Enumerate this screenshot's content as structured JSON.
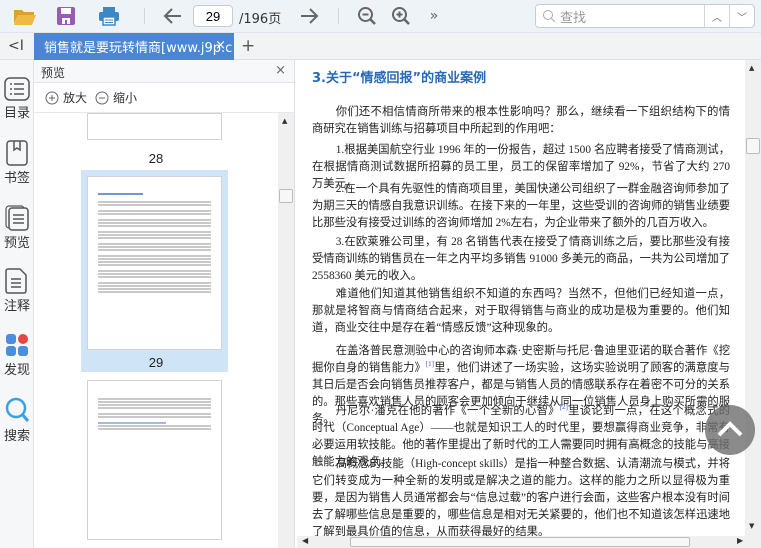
{
  "toolbar": {
    "page_current": "29",
    "page_total": "/196页",
    "search_placeholder": "查找",
    "icons": [
      "folder-open-icon",
      "save-icon",
      "print-icon",
      "arrow-left-icon",
      "arrow-right-icon",
      "zoom-out-icon",
      "zoom-in-icon",
      "more-icon",
      "search-icon",
      "chevron-up-icon",
      "chevron-down-icon"
    ]
  },
  "tabs": {
    "collapse": "<I",
    "doc_tab": "销售就是要玩转情商[www.j9p.c",
    "close": "×",
    "add": "+"
  },
  "rail": [
    {
      "label": "目录",
      "icon": "list-icon"
    },
    {
      "label": "书签",
      "icon": "bookmark-icon"
    },
    {
      "label": "预览",
      "icon": "preview-icon"
    },
    {
      "label": "注释",
      "icon": "note-icon"
    },
    {
      "label": "发现",
      "icon": "discover-icon"
    },
    {
      "label": "搜索",
      "icon": "search-icon"
    }
  ],
  "preview": {
    "title": "预览",
    "close": "×",
    "zoom_in": "放大",
    "zoom_out": "缩小",
    "pages": [
      "28",
      "29"
    ],
    "selected_page": "29"
  },
  "document": {
    "title": "3.关于“情感回报”的商业案例",
    "paragraphs": [
      "你们还不相信情商所带来的根本性影响吗？那么，继续看一下组织结构下的情商研究在销售训练与招募项目中所起到的作用吧：",
      "1.根据美国航空行业 1996 年的一份报告，超过 1500 名应聘者接受了情商测试，在根据情商测试数据所招募的员工里，员工的保留率增加了 92%，节省了大约 270 万美元。",
      "2.在一个具有先驱性的情商项目里，美国快递公司组织了一群金融咨询师参加了为期三天的情感自我意识训练。在接下来的一年里，这些受训的咨询师的销售业绩要比那些没有接受过训练的咨询师增加 2%左右，为企业带来了额外的几百万收入。",
      "3.在欧莱雅公司里，有 28 名销售代表在接受了情商训练之后，要比那些没有接受情商训练的销售员在一年之内平均多销售 91000 多美元的商品，一共为公司增加了 2558360 美元的收入。",
      "难道他们知道其他销售组织不知道的东西吗？当然不，但他们已经知道一点，那就是将智商与情商结合起来，对于取得销售与商业的成功是极为重要的。他们知道，商业交往中是存在着“情感反馈”这种现象的。"
    ],
    "p6a": "在盖洛普民意测验中心的咨询师本森·史密斯与托尼·鲁迪里亚诺的联合著作《挖掘你自身的销售能力》",
    "fn1": "[1]",
    "p6b": "里，他们讲述了一场实验，这场实验说明了顾客的满意度与其日后是否会向销售员推荐客户，都是与销售人员的情感联系存在着密不可分的关系的。那些喜欢销售人员的顾客会更加倾向于继续从同一位销售人员身上购买所需的服务。",
    "p7a": "丹尼尔·潘克在他的著作《一个全新的心智》",
    "fn2": "[2]",
    "p7b": "里谈论到一点，在这个概念式的时代（Conceptual Age）——也就是知识工人的时代里，要想赢得商业竞争，非常有必要运用软技能。他的著作里提出了新时代的工人需要同时拥有高概念的技能与高接触能力的观点。",
    "p8": "高概念的技能（High-concept skills）是指一种整合数据、认清潮流与模式，并将它们转变成为一种全新的发明或是解决之道的能力。这样的能力之所以显得极为重要，是因为销售人员通常都会与“信息过载”的客户进行会面，这些客户根本没有时间去了解哪些信息是重要的，哪些信息是相对无关紧要的，他们也不知道该怎样迅速地了解到最具价值的信息，从而获得最好的结果。"
  },
  "colors": {
    "accent": "#4a86d4",
    "title": "#2a6ab5",
    "selection": "#cfe5f7"
  }
}
